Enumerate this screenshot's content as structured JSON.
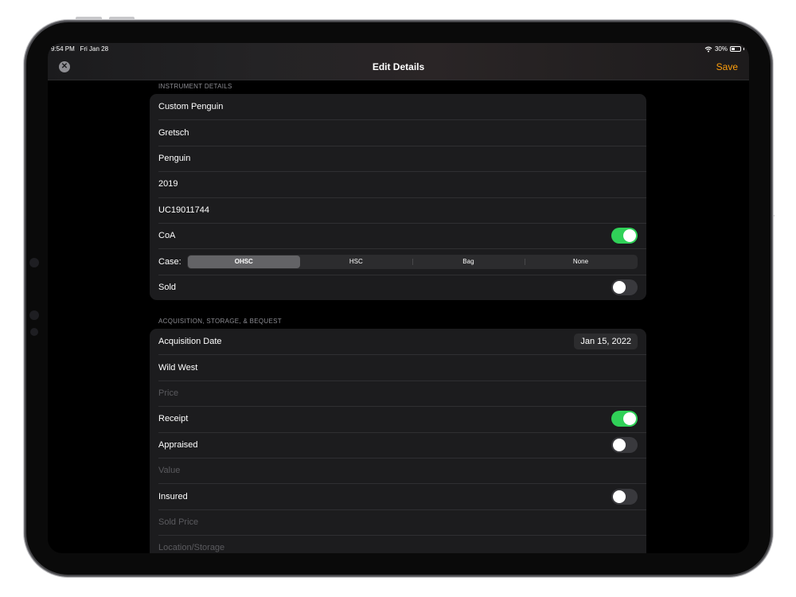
{
  "status": {
    "time": "9:54 PM",
    "date": "Fri Jan 28",
    "battery": "30%"
  },
  "nav": {
    "title": "Edit Details",
    "save": "Save"
  },
  "instrument": {
    "header": "INSTRUMENT DETAILS",
    "model": "Custom Penguin",
    "brand": "Gretsch",
    "name": "Penguin",
    "year": "2019",
    "serial": "UC19011744",
    "coa_label": "CoA",
    "coa_on": true,
    "case_label": "Case:",
    "case_options": [
      "OHSC",
      "HSC",
      "Bag",
      "None"
    ],
    "case_selected": "OHSC",
    "sold_label": "Sold",
    "sold_on": false
  },
  "acquisition": {
    "header": "ACQUISITION, STORAGE, & BEQUEST",
    "date_label": "Acquisition Date",
    "date_value": "Jan 15, 2022",
    "seller": "Wild West",
    "price_placeholder": "Price",
    "receipt_label": "Receipt",
    "receipt_on": true,
    "appraised_label": "Appraised",
    "appraised_on": false,
    "value_placeholder": "Value",
    "insured_label": "Insured",
    "insured_on": false,
    "sold_price_placeholder": "Sold Price",
    "location_placeholder": "Location/Storage"
  },
  "colors": {
    "accent": "#ff9f0a",
    "toggle_on": "#30d158",
    "background": "#000000",
    "cell": "#1c1c1e"
  }
}
